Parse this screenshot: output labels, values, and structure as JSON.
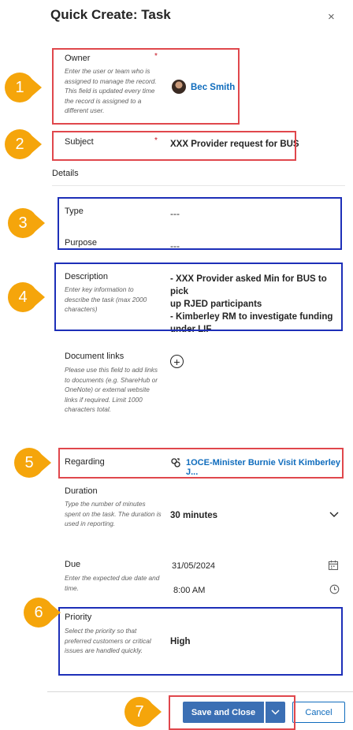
{
  "dialog": {
    "title": "Quick Create: Task",
    "close_glyph": "×"
  },
  "owner": {
    "label": "Owner",
    "required_mark": "*",
    "help": "Enter the user or team who is assigned to manage the record. This field is updated every time the record is assigned to a different user.",
    "value": "Bec Smith"
  },
  "subject": {
    "label": "Subject",
    "required_mark": "*",
    "value": "XXX Provider request for BUS"
  },
  "section": {
    "details": "Details"
  },
  "type": {
    "label": "Type",
    "value": "---"
  },
  "purpose": {
    "label": "Purpose",
    "value": "---"
  },
  "description": {
    "label": "Description",
    "help": "Enter key information to describe the task (max 2000 characters)",
    "lines": [
      "- XXX Provider asked Min for BUS to pick",
      "up RJED participants",
      "- Kimberley RM to investigate funding",
      "under LIF"
    ]
  },
  "document_links": {
    "label": "Document links",
    "help": "Please use this field to add links to documents (e.g. ShareHub or OneNote) or external website links if required. Limit 1000 characters total.",
    "add_glyph": "+"
  },
  "regarding": {
    "label": "Regarding",
    "value": "1OCE-Minister Burnie Visit Kimberley J..."
  },
  "duration": {
    "label": "Duration",
    "help": "Type the number of minutes spent on the task. The duration is used in reporting.",
    "value": "30 minutes"
  },
  "due": {
    "label": "Due",
    "help": "Enter the expected due date and time.",
    "date": "31/05/2024",
    "time": "8:00 AM"
  },
  "priority": {
    "label": "Priority",
    "help": "Select the priority so that preferred customers or critical issues are handled quickly.",
    "value": "High"
  },
  "footer": {
    "save_label": "Save and Close",
    "cancel_label": "Cancel"
  },
  "markers": [
    "1",
    "2",
    "3",
    "4",
    "5",
    "6",
    "7"
  ],
  "colors": {
    "marker": "#f5a50b",
    "annotation_red": "#e0474c",
    "annotation_blue": "#1d2fb8",
    "primary": "#3b6fb4",
    "link": "#0f6cbd",
    "required": "#c50f1f"
  }
}
